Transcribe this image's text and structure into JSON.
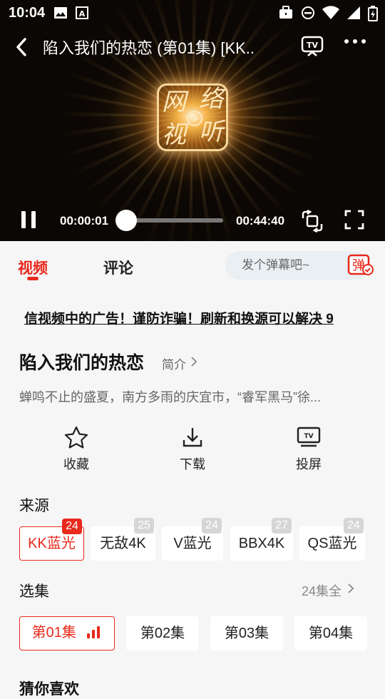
{
  "status_bar": {
    "time": "10:04"
  },
  "player": {
    "title": "陷入我们的热恋 (第01集) [KK..",
    "current_time": "00:00:01",
    "total_time": "00:44:40",
    "progress": 0.0004,
    "logo_chars": [
      "网",
      "络",
      "视",
      "听"
    ]
  },
  "tabs": {
    "video": "视频",
    "comments": "评论"
  },
  "danmu": {
    "placeholder": "发个弹幕吧~",
    "button": "弹"
  },
  "notice": "信视频中的广告！谨防诈骗！刷新和换源可以解决 9",
  "show": {
    "title": "陷入我们的热恋",
    "intro_label": "简介",
    "description": "蝉鸣不止的盛夏，南方多雨的庆宜市，“睿军黑马”徐..."
  },
  "actions": {
    "favorite": "收藏",
    "download": "下载",
    "cast": "投屏",
    "tv_text": "TV"
  },
  "sources": {
    "title": "来源",
    "items": [
      {
        "label": "KK蓝光",
        "count": "24",
        "active": true
      },
      {
        "label": "无敌4K",
        "count": "25"
      },
      {
        "label": "V蓝光",
        "count": "24"
      },
      {
        "label": "BBX4K",
        "count": "27"
      },
      {
        "label": "QS蓝光",
        "count": "24"
      }
    ]
  },
  "episodes": {
    "title": "选集",
    "all_label": "24集全",
    "items": [
      {
        "label": "第01集",
        "active": true
      },
      {
        "label": "第02集"
      },
      {
        "label": "第03集"
      },
      {
        "label": "第04集"
      }
    ]
  },
  "next_section": {
    "title": "猜你喜欢"
  },
  "colors": {
    "accent": "#e8291c",
    "badge_inactive": "#d6d6d6"
  }
}
